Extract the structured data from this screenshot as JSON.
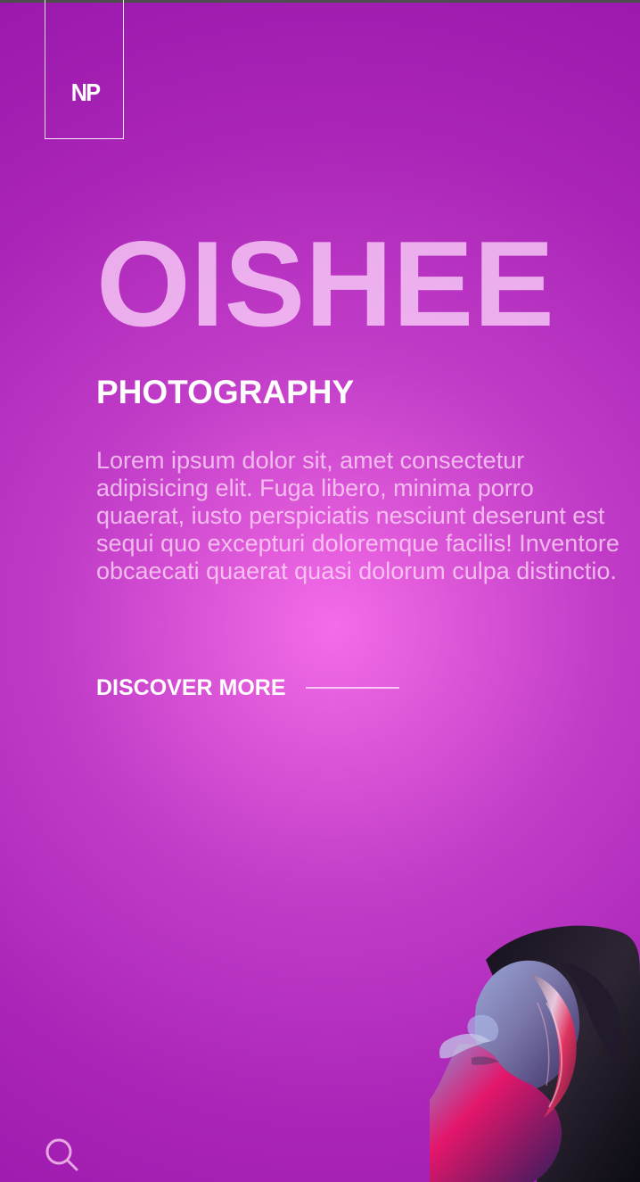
{
  "brand": {
    "logo_text": "NP",
    "name": "OISHEE",
    "tagline": "PHOTOGRAPHY"
  },
  "hero": {
    "description": "Lorem ipsum dolor sit, amet consectetur adipisicing elit. Fuga libero, minima porro quaerat, iusto perspiciatis nesciunt deserunt est sequi quo excepturi doloremque facilis! Inventore obcaecati quaerat quasi dolorum culpa distinctio.",
    "cta_label": "DISCOVER MORE"
  },
  "icons": {
    "search": "search-icon"
  },
  "colors": {
    "gradient_center": "#f46ce8",
    "gradient_edge": "#9a18ad",
    "title_text": "#ffdafc",
    "white": "#ffffff"
  }
}
